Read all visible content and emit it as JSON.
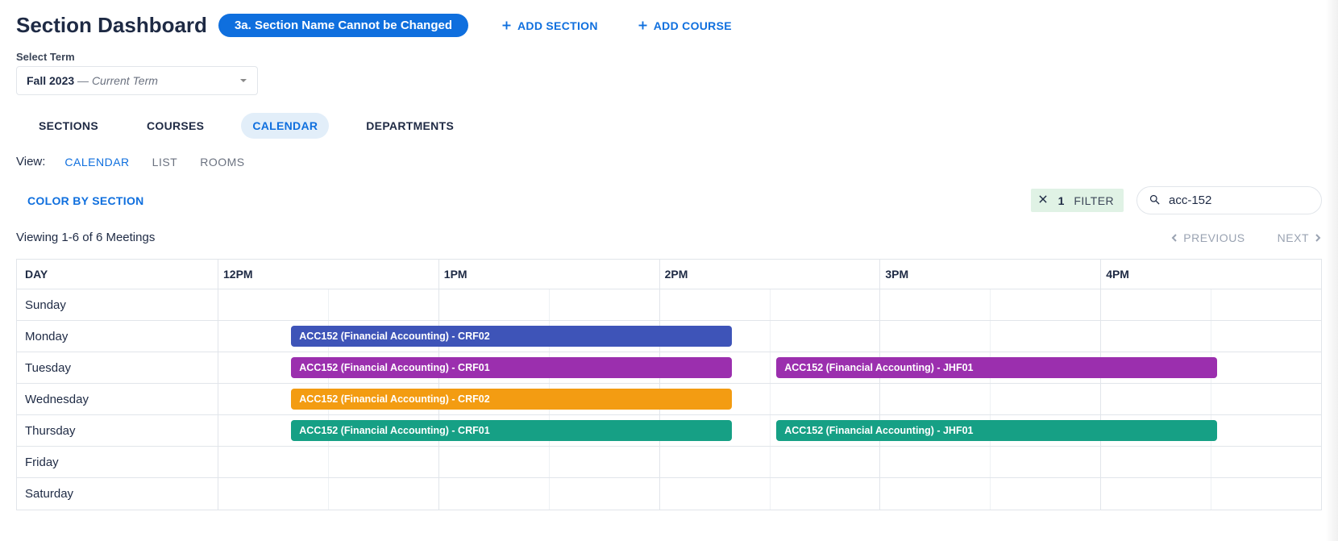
{
  "header": {
    "title": "Section Dashboard",
    "badge": "3a. Section Name Cannot be Changed",
    "add_section_label": "ADD SECTION",
    "add_course_label": "ADD COURSE"
  },
  "term": {
    "label": "Select Term",
    "value": "Fall 2023",
    "suffix": "Current Term"
  },
  "tabs": [
    {
      "label": "SECTIONS",
      "active": false
    },
    {
      "label": "COURSES",
      "active": false
    },
    {
      "label": "CALENDAR",
      "active": true
    },
    {
      "label": "DEPARTMENTS",
      "active": false
    }
  ],
  "view": {
    "label": "View:",
    "options": [
      {
        "label": "CALENDAR",
        "active": true
      },
      {
        "label": "LIST",
        "active": false
      },
      {
        "label": "ROOMS",
        "active": false
      }
    ]
  },
  "toolbar": {
    "color_by_section": "COLOR BY SECTION",
    "filter_count": "1",
    "filter_label": "FILTER",
    "search_value": "acc-152"
  },
  "pager": {
    "summary": "Viewing 1-6 of 6 Meetings",
    "previous": "PREVIOUS",
    "next": "NEXT"
  },
  "calendar": {
    "day_header": "DAY",
    "hours_start_12": 12,
    "hours": [
      "12PM",
      "1PM",
      "2PM",
      "3PM",
      "4PM"
    ],
    "days": [
      "Sunday",
      "Monday",
      "Tuesday",
      "Wednesday",
      "Thursday",
      "Friday",
      "Saturday"
    ],
    "colors": {
      "crf02_mon": "#3E54B8",
      "crf01_tue": "#9B2FAE",
      "jhf01_tue": "#9B2FAE",
      "crf02_wed": "#F39C12",
      "crf01_thu": "#16A085",
      "jhf01_thu": "#16A085"
    },
    "events": [
      {
        "day": 1,
        "start": 12.33,
        "end": 14.33,
        "label": "ACC152 (Financial Accounting) - CRF02",
        "color_key": "crf02_mon"
      },
      {
        "day": 2,
        "start": 12.33,
        "end": 14.33,
        "label": "ACC152 (Financial Accounting) - CRF01",
        "color_key": "crf01_tue"
      },
      {
        "day": 2,
        "start": 14.53,
        "end": 16.53,
        "label": "ACC152 (Financial Accounting) - JHF01",
        "color_key": "jhf01_tue"
      },
      {
        "day": 3,
        "start": 12.33,
        "end": 14.33,
        "label": "ACC152 (Financial Accounting) - CRF02",
        "color_key": "crf02_wed"
      },
      {
        "day": 4,
        "start": 12.33,
        "end": 14.33,
        "label": "ACC152 (Financial Accounting) - CRF01",
        "color_key": "crf01_thu"
      },
      {
        "day": 4,
        "start": 14.53,
        "end": 16.53,
        "label": "ACC152 (Financial Accounting) - JHF01",
        "color_key": "jhf01_thu"
      }
    ]
  }
}
